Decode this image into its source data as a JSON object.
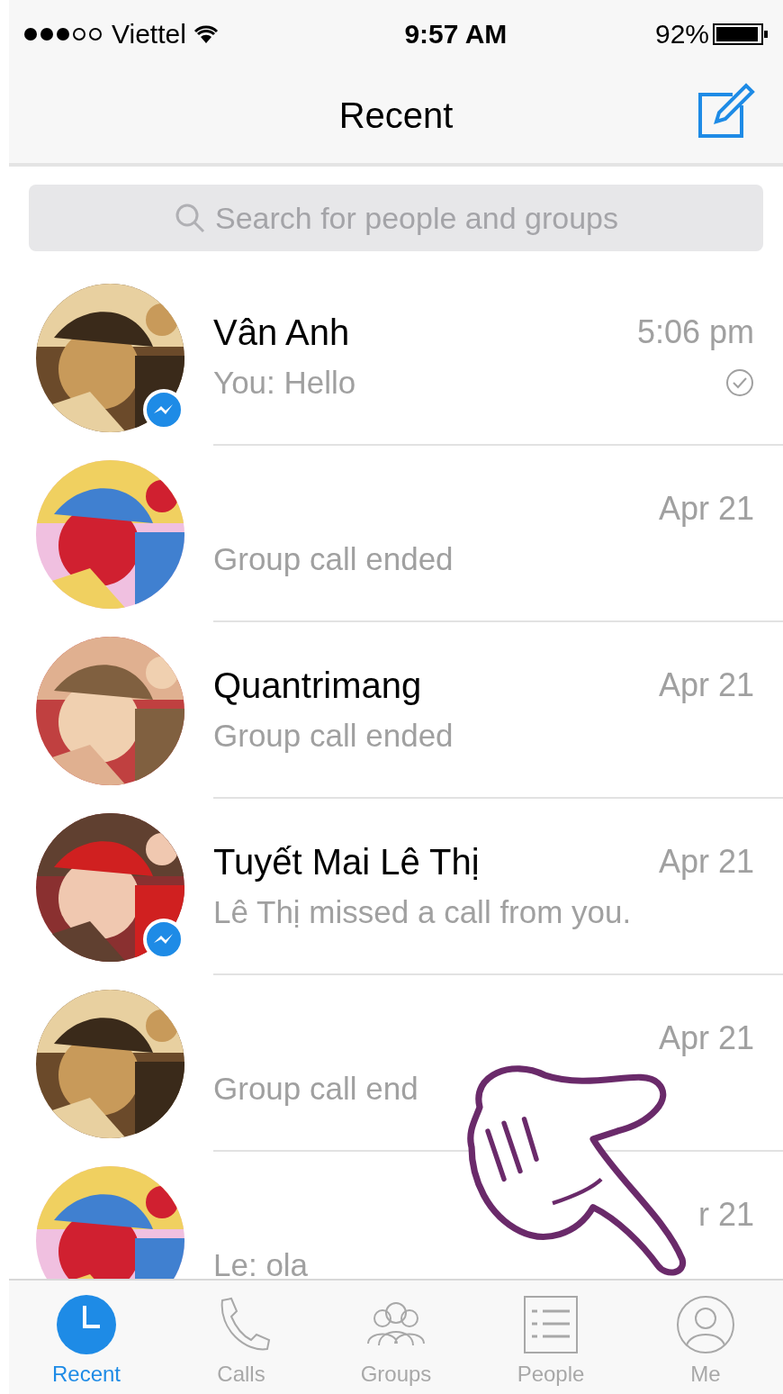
{
  "status_bar": {
    "carrier": "Viettel",
    "time": "9:57 AM",
    "battery": "92%"
  },
  "nav": {
    "title": "Recent"
  },
  "search": {
    "placeholder": "Search for people and groups"
  },
  "conversations": [
    {
      "name": "Vân Anh",
      "time": "5:06 pm",
      "preview": "You: Hello",
      "messenger_badge": true,
      "seen": true
    },
    {
      "time": "Apr 21",
      "preview": "Group call ended",
      "messenger_badge": false,
      "seen": false
    },
    {
      "name": "Quantrimang",
      "time": "Apr 21",
      "preview": "Group call ended",
      "messenger_badge": false,
      "seen": false
    },
    {
      "name": "Tuyết Mai Lê Thị",
      "time": "Apr 21",
      "preview": "Lê Thị missed a call from you.",
      "messenger_badge": true,
      "seen": false
    },
    {
      "time": "Apr 21",
      "preview": "Group call end",
      "messenger_badge": false,
      "seen": false
    },
    {
      "time": "r 21",
      "preview": "Le: ola",
      "messenger_badge": false,
      "seen": false
    }
  ],
  "tabs": [
    {
      "label": "Recent",
      "kind": "clock",
      "selected": true
    },
    {
      "label": "Calls",
      "kind": "phone",
      "selected": false
    },
    {
      "label": "Groups",
      "kind": "groups",
      "selected": false
    },
    {
      "label": "People",
      "kind": "list",
      "selected": false
    },
    {
      "label": "Me",
      "kind": "person",
      "selected": false
    }
  ]
}
